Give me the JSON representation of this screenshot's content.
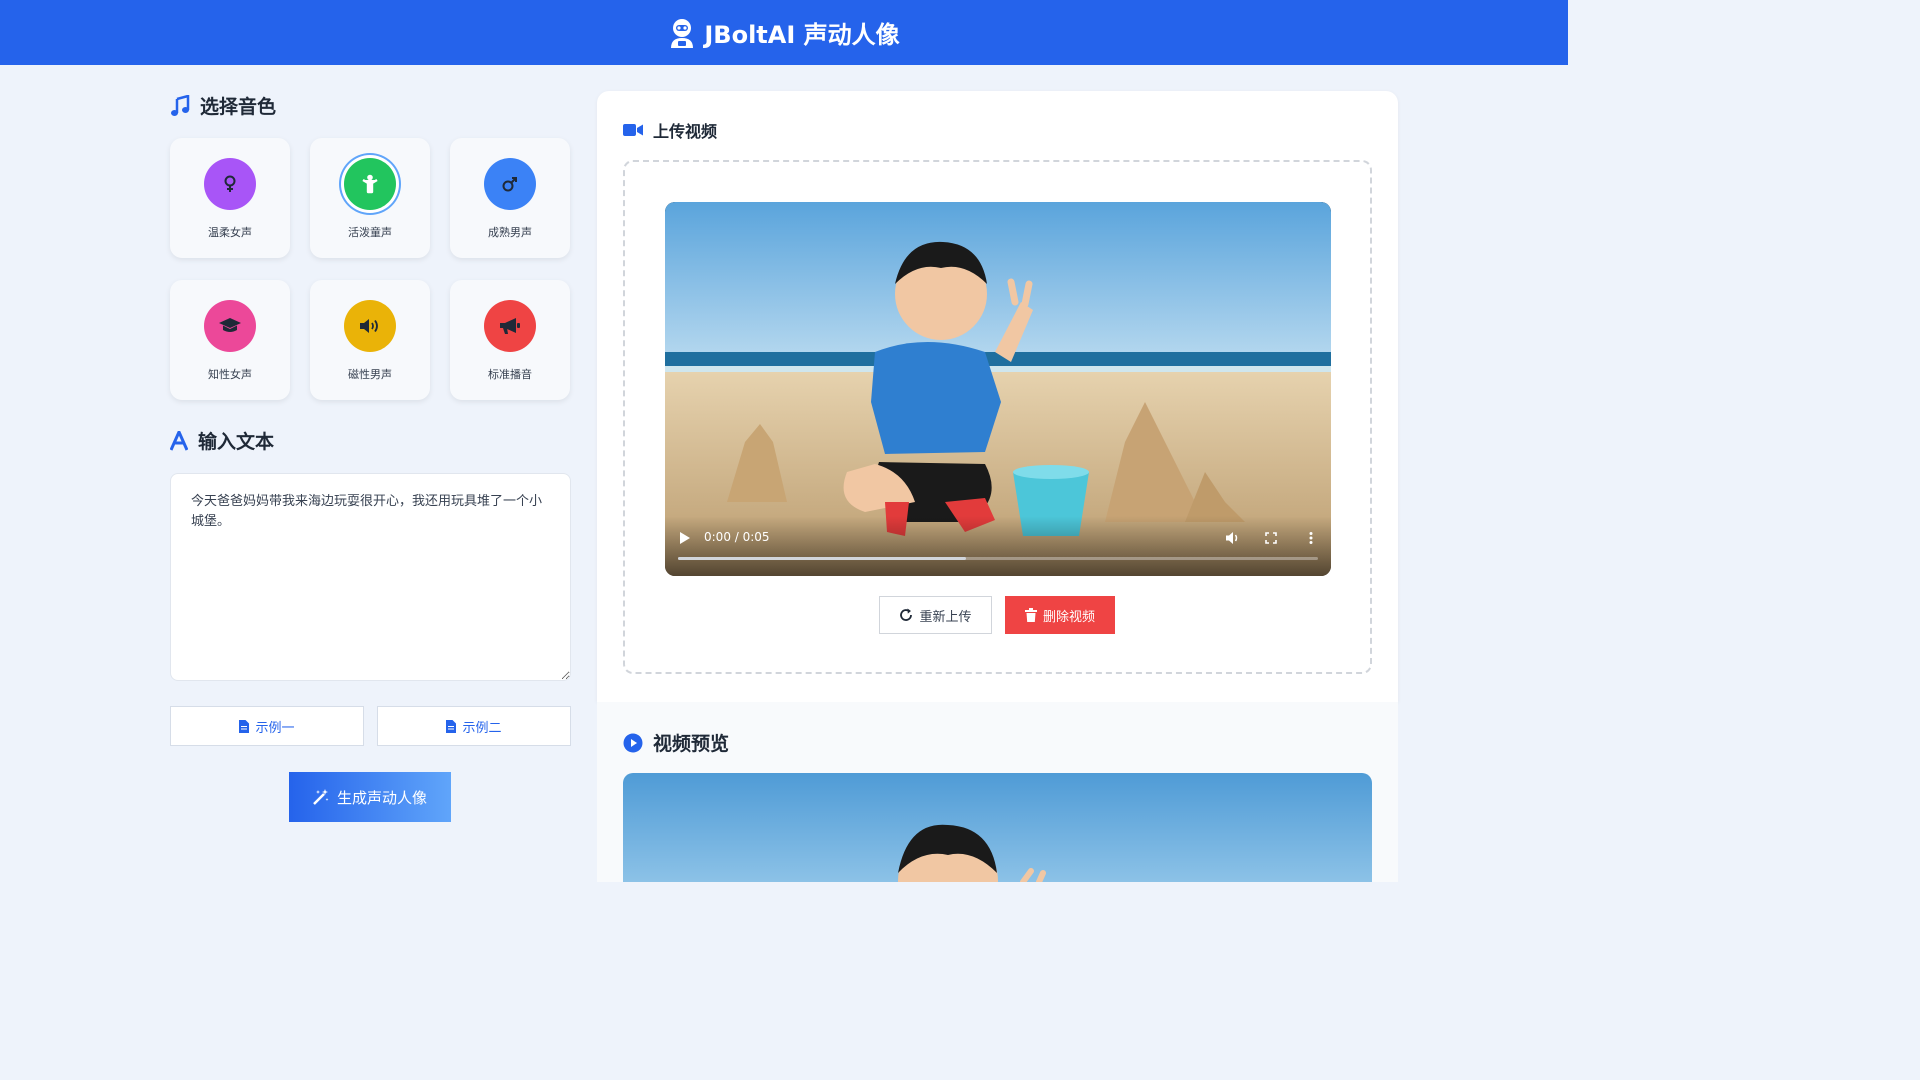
{
  "header": {
    "title": "JBoltAI 声动人像"
  },
  "voice_section": {
    "title": "选择音色"
  },
  "voices": [
    {
      "label": "温柔女声",
      "color": "#a855f7",
      "icon": "venus-icon",
      "selected": false
    },
    {
      "label": "活泼童声",
      "color": "#22c55e",
      "icon": "child-icon",
      "selected": true
    },
    {
      "label": "成熟男声",
      "color": "#3b82f6",
      "icon": "mars-icon",
      "selected": false
    },
    {
      "label": "知性女声",
      "color": "#ec4899",
      "icon": "graduation-cap-icon",
      "selected": false
    },
    {
      "label": "磁性男声",
      "color": "#eab308",
      "icon": "volume-icon",
      "selected": false
    },
    {
      "label": "标准播音",
      "color": "#ef4444",
      "icon": "megaphone-icon",
      "selected": false
    }
  ],
  "text_section": {
    "title": "输入文本",
    "value": "今天爸爸妈妈带我来海边玩耍很开心，我还用玩具堆了一个小城堡。"
  },
  "examples": {
    "example1": "示例一",
    "example2": "示例二"
  },
  "generate": {
    "label": "生成声动人像"
  },
  "upload_section": {
    "title": "上传视频"
  },
  "player": {
    "time": "0:00 / 0:05",
    "progress": 0.45
  },
  "upload_actions": {
    "reupload": "重新上传",
    "delete": "删除视频"
  },
  "preview_section": {
    "title": "视频预览"
  },
  "colors": {
    "primary": "#2563eb",
    "danger": "#ef4444"
  }
}
